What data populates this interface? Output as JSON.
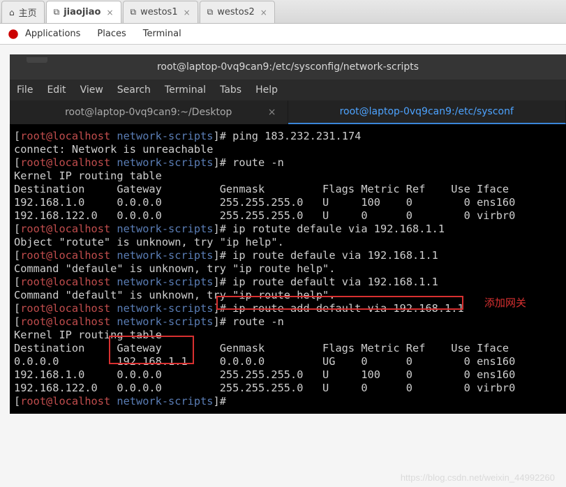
{
  "browser_tabs": [
    {
      "label": "主页",
      "icon": "⌂"
    },
    {
      "label": "jiaojiao",
      "icon": "⧉"
    },
    {
      "label": "westos1",
      "icon": "⧉"
    },
    {
      "label": "westos2",
      "icon": "⧉"
    }
  ],
  "gnome": {
    "applications": "Applications",
    "places": "Places",
    "terminal": "Terminal"
  },
  "titlebar": "root@laptop-0vq9can9:/etc/sysconfig/network-scripts",
  "menus": [
    "File",
    "Edit",
    "View",
    "Search",
    "Terminal",
    "Tabs",
    "Help"
  ],
  "term_tabs": [
    {
      "label": "root@laptop-0vq9can9:~/Desktop"
    },
    {
      "label": "root@laptop-0vq9can9:/etc/sysconf"
    }
  ],
  "prompt_user": "root@localhost",
  "prompt_path": "network-scripts",
  "lines": {
    "l1_cmd": "ping 183.232.231.174",
    "l2": "connect: Network is unreachable",
    "l3_cmd": "route -n",
    "l4": "Kernel IP routing table",
    "l5": "Destination     Gateway         Genmask         Flags Metric Ref    Use Iface",
    "l6": "192.168.1.0     0.0.0.0         255.255.255.0   U     100    0        0 ens160",
    "l7": "192.168.122.0   0.0.0.0         255.255.255.0   U     0      0        0 virbr0",
    "l8_cmd": "ip rotute defaule via 192.168.1.1",
    "l9": "Object \"rotute\" is unknown, try \"ip help\".",
    "l10_cmd": "ip route defaule via 192.168.1.1",
    "l11": "Command \"defaule\" is unknown, try \"ip route help\".",
    "l12_cmd": "ip route default via 192.168.1.1",
    "l13": "Command \"default\" is unknown, try \"ip route help\".",
    "l14_cmd": "ip route add default via 192.168.1.1",
    "l15_cmd": "route -n",
    "l16": "Kernel IP routing table",
    "l17": "Destination     Gateway         Genmask         Flags Metric Ref    Use Iface",
    "l18": "0.0.0.0         192.168.1.1     0.0.0.0         UG    0      0        0 ens160",
    "l19": "192.168.1.0     0.0.0.0         255.255.255.0   U     100    0        0 ens160",
    "l20": "192.168.122.0   0.0.0.0         255.255.255.0   U     0      0        0 virbr0"
  },
  "annotation": "添加网关",
  "watermark": "https://blog.csdn.net/weixin_44992260"
}
